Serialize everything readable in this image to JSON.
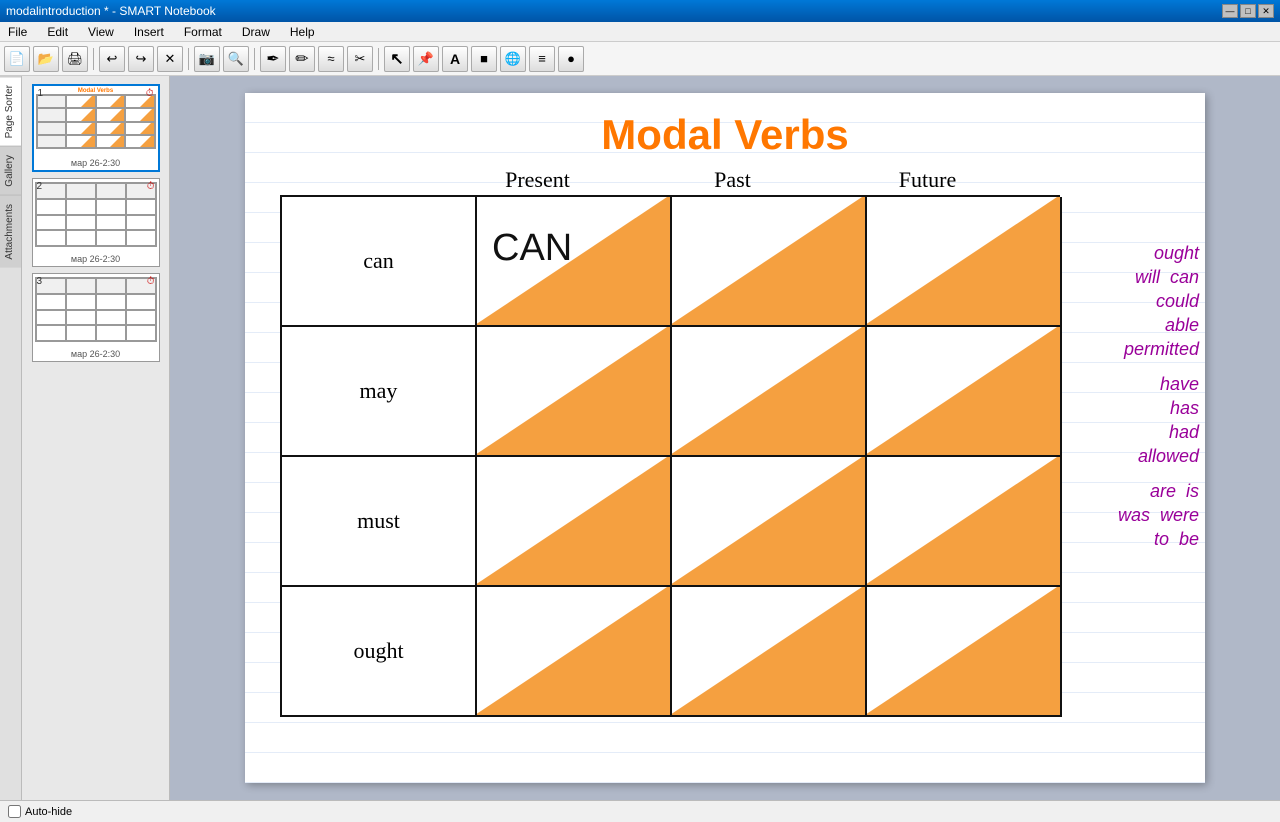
{
  "window": {
    "title": "modalintroduction * - SMART Notebook",
    "controls": [
      "—",
      "□",
      "✕"
    ]
  },
  "menubar": {
    "items": [
      "File",
      "Edit",
      "View",
      "Insert",
      "Format",
      "Draw",
      "Help"
    ]
  },
  "toolbar": {
    "buttons": [
      "📄",
      "📂",
      "🖨",
      "↩",
      "↪",
      "✕",
      "📷",
      "🔍",
      "✒",
      "✏",
      "≈",
      "✂",
      "📌",
      "A",
      "■",
      "🌐",
      "≡",
      "●"
    ]
  },
  "sidebar": {
    "tabs": [
      "Page Sorter",
      "Gallery",
      "Attachments"
    ],
    "pages": [
      {
        "number": "1",
        "label": "мар 26-2:30",
        "active": true
      },
      {
        "number": "2",
        "label": "мар 26-2:30"
      },
      {
        "number": "3",
        "label": "мар 26-2:30"
      }
    ]
  },
  "page": {
    "title": "Modal Verbs",
    "col_headers": [
      "Present",
      "Past",
      "Future"
    ],
    "row_labels": [
      "can",
      "may",
      "must",
      "ought"
    ],
    "handwritten_cell": {
      "row": 0,
      "col": 0,
      "text": "CAN"
    },
    "right_words": {
      "group1": [
        [
          "ought"
        ],
        [
          "will",
          "can"
        ],
        [
          "could"
        ],
        [
          "able"
        ],
        [
          "permitted"
        ]
      ],
      "group2": [
        [
          "have"
        ],
        [
          "has"
        ],
        [
          "had"
        ],
        [
          "allowed"
        ]
      ],
      "group3": [
        [
          "are",
          "is"
        ],
        [
          "was",
          "were"
        ],
        [
          "to",
          "be"
        ]
      ]
    }
  },
  "statusbar": {
    "autohide_label": "Auto-hide"
  }
}
